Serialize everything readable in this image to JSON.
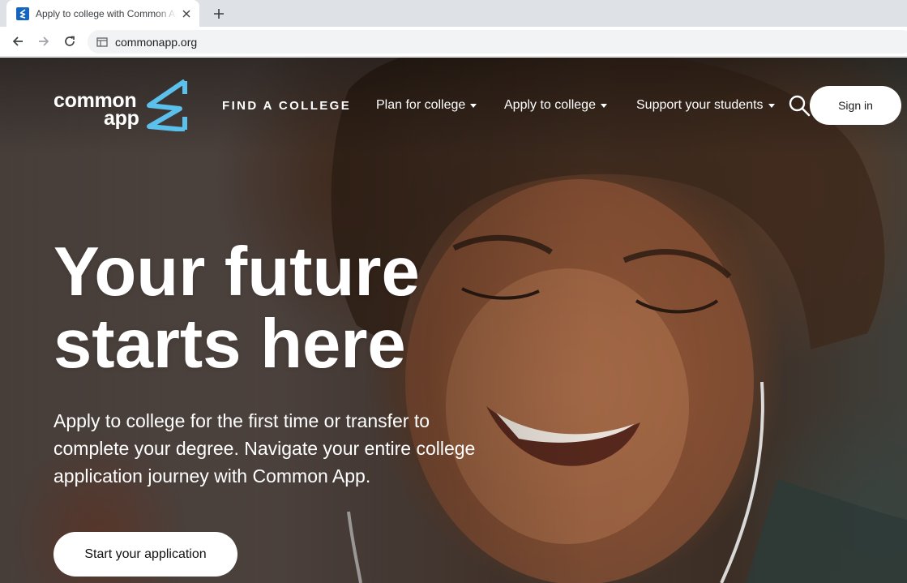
{
  "browser": {
    "tab_title": "Apply to college with Common App",
    "url": "commonapp.org",
    "favicon": "common-app-favicon",
    "icons": {
      "close": "close-icon",
      "new_tab": "plus-icon",
      "back": "arrow-left-icon",
      "forward": "arrow-right-icon",
      "reload": "reload-icon",
      "site_info": "site-info-icon"
    }
  },
  "header": {
    "logo": {
      "word1": "common",
      "word2": "app",
      "mark": "common-app-logo-mark"
    },
    "nav": {
      "find_college": "FIND A COLLEGE",
      "plan": "Plan for college",
      "apply": "Apply to college",
      "support": "Support your students"
    },
    "search_icon": "search-icon",
    "signin_label": "Sign in"
  },
  "hero": {
    "headline_line1": "Your future",
    "headline_line2": "starts here",
    "subtext_line1": "Apply to college for the first time or transfer to",
    "subtext_line2": "complete your degree. Navigate your entire college",
    "subtext_line3": "application journey with Common App.",
    "cta_label": "Start your application"
  },
  "colors": {
    "brand_accent": "#5bc0eb",
    "favicon_blue": "#1565c0",
    "button_bg": "#ffffff",
    "text_on_hero": "#ffffff"
  }
}
